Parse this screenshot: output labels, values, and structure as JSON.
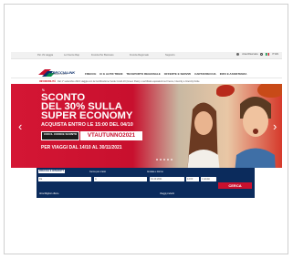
{
  "topbar": {
    "links": [
      "Per chi viaggia",
      "Le Frecce Rap",
      "Freccia Per Business",
      "Freccia Regionale",
      "Supporto"
    ],
    "login_label": "Area Riservata",
    "lang": "IT EN"
  },
  "header": {
    "logo_text": "FRECCIALINK",
    "logo_sub": "TRENITALIA LE FRECCE",
    "nav": [
      "FRECCE",
      "IC E ALTRI TRENI",
      "TRASPORTO REGIONALE",
      "OFFERTE E SERVIZI",
      "CARTAFRECCIA",
      "INFO E ASSISTENZA"
    ]
  },
  "ticker": {
    "tag": "INFOMOBILITÀ",
    "message": "Dal 1° settembre 2021 viaggia con la Certificazione Verde Covid-19 (Green Pass) o certificati equivalenti su Frecce, Intercity e Intercity Notte"
  },
  "hero": {
    "label": "%",
    "title_lines": [
      "SCONTO",
      "DEL 30% SULLA",
      "SUPER ECONOMY"
    ],
    "subtitle": "ACQUISTA ENTRO LE 15:00 DEL 04/10",
    "code_label": "CON IL CODICE SCONTO",
    "code_value": "VTAUTUNNO2021",
    "dates": "PER VIAGGI DAL 14/10 AL 30/11/2021",
    "prev_arrow": "‹",
    "next_arrow": "›",
    "colors": {
      "brand": "#c8102e",
      "navy": "#0b2b5c"
    }
  },
  "search": {
    "tabs": [
      "FRECCIA E INTERCITY",
      "Cerca per orario",
      "Andata e ritorno"
    ],
    "from": "Da",
    "to": "A",
    "date": "01.10.2021",
    "time": "14:00",
    "passengers": "1 Adulto",
    "search_button": "CERCA",
    "bottom_left": "Altre/Migliori offerte",
    "bottom_right": "Viaggi preferiti"
  }
}
